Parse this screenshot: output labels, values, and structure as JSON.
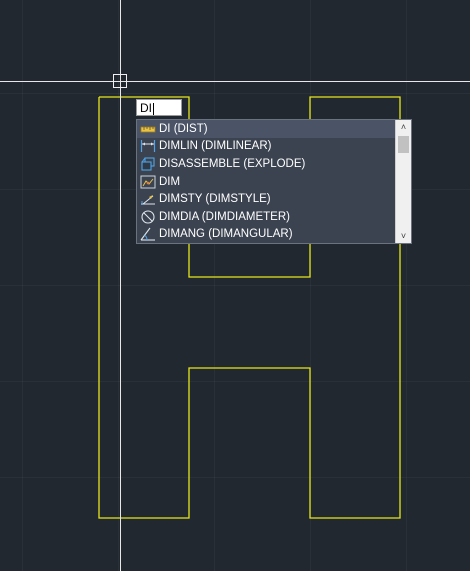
{
  "command_line": {
    "input_value": "DI"
  },
  "autocomplete": {
    "items": [
      {
        "label": "DI (DIST)",
        "icon": "measure-distance-icon",
        "selected": true
      },
      {
        "label": "DIMLIN (DIMLINEAR)",
        "icon": "linear-dimension-icon",
        "selected": false
      },
      {
        "label": "DISASSEMBLE (EXPLODE)",
        "icon": "explode-icon",
        "selected": false
      },
      {
        "label": "DIM",
        "icon": "dimension-icon",
        "selected": false
      },
      {
        "label": "DIMSTY (DIMSTYLE)",
        "icon": "dimension-style-icon",
        "selected": false
      },
      {
        "label": "DIMDIA (DIMDIAMETER)",
        "icon": "diameter-dimension-icon",
        "selected": false
      },
      {
        "label": "DIMANG (DIMANGULAR)",
        "icon": "angular-dimension-icon",
        "selected": false
      }
    ]
  },
  "colors": {
    "background": "#212830",
    "geometry": "#e6e61a",
    "crosshair": "#e8e8e8",
    "list_background": "#3b4350",
    "list_selected": "#4a5466",
    "icon_blue": "#4fa3e6"
  }
}
